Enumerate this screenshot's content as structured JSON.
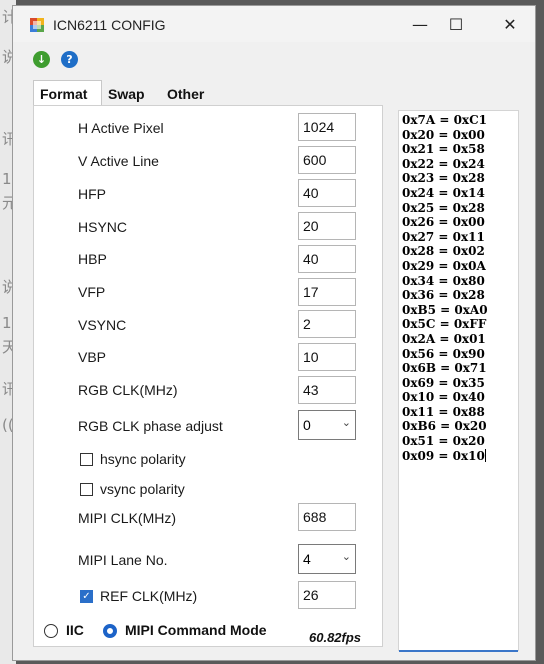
{
  "window": {
    "title": "ICN6211 CONFIG",
    "minimize": "—",
    "maximize": "☐",
    "close": "✕"
  },
  "toolbar": {
    "go_icon": "↓",
    "help_icon": "?"
  },
  "tabs": [
    "Format",
    "Swap",
    "Other"
  ],
  "format": {
    "h_active_pixel": {
      "label": "H Active Pixel",
      "value": "1024"
    },
    "v_active_line": {
      "label": "V Active Line",
      "value": "600"
    },
    "hfp": {
      "label": "HFP",
      "value": "40"
    },
    "hsync": {
      "label": "HSYNC",
      "value": "20"
    },
    "hbp": {
      "label": "HBP",
      "value": "40"
    },
    "vfp": {
      "label": "VFP",
      "value": "17"
    },
    "vsync": {
      "label": "VSYNC",
      "value": "2"
    },
    "vbp": {
      "label": "VBP",
      "value": "10"
    },
    "rgb_clk": {
      "label": "RGB CLK(MHz)",
      "value": "43"
    },
    "rgb_clk_phase": {
      "label": "RGB CLK phase adjust",
      "value": "0"
    },
    "hsync_polarity": {
      "label": "hsync polarity",
      "checked": false
    },
    "vsync_polarity": {
      "label": "vsync polarity",
      "checked": false
    },
    "mipi_clk": {
      "label": "MIPI CLK(MHz)",
      "value": "688"
    },
    "mipi_lane": {
      "label": "MIPI Lane No.",
      "value": "4"
    },
    "ref_clk": {
      "label": "REF CLK(MHz)",
      "value": "26",
      "checked": true
    }
  },
  "mode": {
    "iic_label": "IIC",
    "mipi_cmd_label": "MIPI Command Mode",
    "selected": "MIPI Command Mode"
  },
  "fps": "60.82fps",
  "registers": [
    "0x7A = 0xC1",
    "0x20 = 0x00",
    "0x21 = 0x58",
    "0x22 = 0x24",
    "0x23 = 0x28",
    "0x24 = 0x14",
    "0x25 = 0x28",
    "0x26 = 0x00",
    "0x27 = 0x11",
    "0x28 = 0x02",
    "0x29 = 0x0A",
    "0x34 = 0x80",
    "0x36 = 0x28",
    "0xB5 = 0xA0",
    "0x5C = 0xFF",
    "0x2A = 0x01",
    "0x56 = 0x90",
    "0x6B = 0x71",
    "0x69 = 0x35",
    "0x10 = 0x40",
    "0x11 = 0x88",
    "0xB6 = 0x20",
    "0x51 = 0x20",
    "0x09 = 0x10"
  ],
  "background_chars": [
    "计",
    "说",
    "讯",
    "1",
    "元",
    "说",
    "1",
    "天",
    "讯",
    "(("
  ]
}
